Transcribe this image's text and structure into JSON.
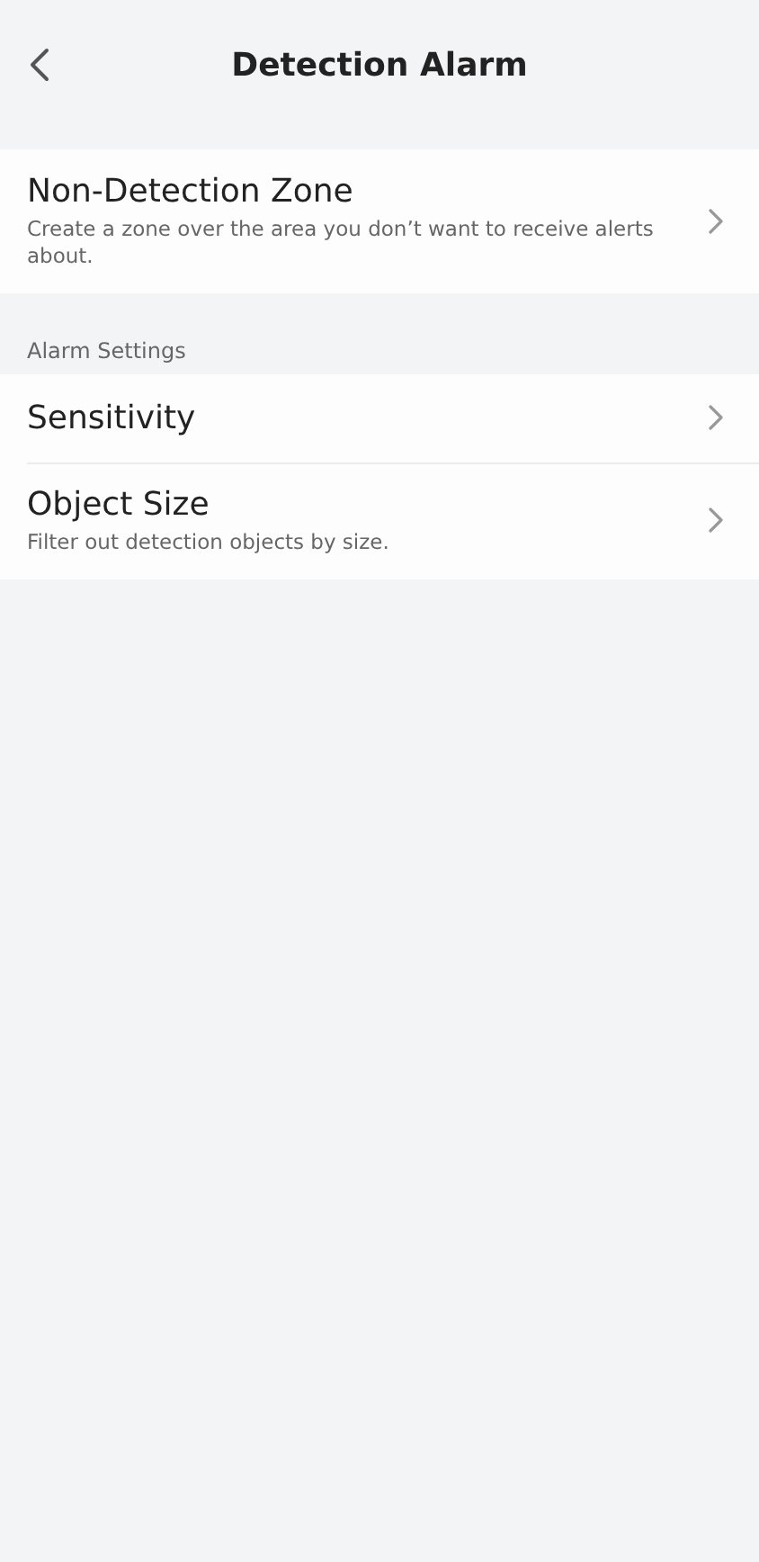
{
  "header": {
    "title": "Detection Alarm"
  },
  "sections": [
    {
      "items": [
        {
          "title": "Non-Detection Zone",
          "description": "Create a zone over the area you don’t want to receive alerts about."
        }
      ]
    },
    {
      "label": "Alarm Settings",
      "items": [
        {
          "title": "Sensitivity"
        },
        {
          "title": "Object Size",
          "description": "Filter out detection objects by size."
        }
      ]
    }
  ]
}
